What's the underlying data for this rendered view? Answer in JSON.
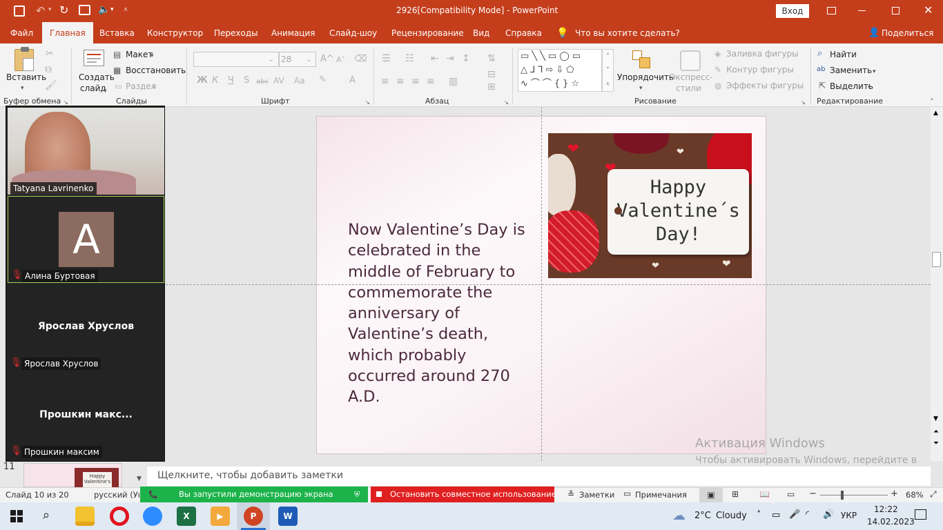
{
  "window": {
    "title": "2926[Compatibility Mode]  -  PowerPoint",
    "signin_label": "Вход"
  },
  "ribbon_tabs": [
    "Файл",
    "Главная",
    "Вставка",
    "Конструктор",
    "Переходы",
    "Анимация",
    "Слайд-шоу",
    "Рецензирование",
    "Вид",
    "Справка"
  ],
  "tell_me": "Что вы хотите сделать?",
  "share_label": "Поделиться",
  "ribbon": {
    "clipboard": {
      "paste": "Вставить",
      "group": "Буфер обмена"
    },
    "slides": {
      "new_slide_line1": "Создать",
      "new_slide_line2": "слайд",
      "layout": "Макет",
      "reset": "Восстановить",
      "section": "Раздел",
      "group": "Слайды"
    },
    "font": {
      "size": "28",
      "bold": "Ж",
      "italic": "К",
      "underline": "Ч",
      "shadow": "S",
      "strike": "abc",
      "case": "Aa",
      "color": "A",
      "group": "Шрифт"
    },
    "paragraph": {
      "group": "Абзац"
    },
    "drawing": {
      "arrange": "Упорядочить",
      "quick_styles_line1": "Экспресс-",
      "quick_styles_line2": "стили",
      "fill": "Заливка фигуры",
      "outline": "Контур фигуры",
      "effects": "Эффекты фигуры",
      "group": "Рисование"
    },
    "editing": {
      "find": "Найти",
      "replace": "Заменить",
      "select": "Выделить",
      "group": "Редактирование"
    }
  },
  "participants": [
    {
      "name": "Tatyana Lavrinenko",
      "type": "video"
    },
    {
      "name": "Алина Буртовая",
      "type": "avatar",
      "initial": "A",
      "avatar_color": "#8c6b60"
    },
    {
      "name": "Ярослав Хруслов",
      "type": "name",
      "display": "Ярослав Хруслов"
    },
    {
      "name": "Прошкин максим",
      "type": "name",
      "display": "Прошкин  макс..."
    }
  ],
  "slide": {
    "body": "Now Valentine’s Day is celebrated in the middle of February to commemorate the anniversary of Valentine’s death, which probably occurred around 270 A.D.",
    "image_text_line1": "Happy",
    "image_text_line2": "Valentine´s",
    "image_text_line3": "Day!"
  },
  "thumbnail": {
    "number": "11",
    "caption_line1": "Happy",
    "caption_line2": "Valentine's"
  },
  "notes_placeholder": "Щелкните, чтобы добавить заметки",
  "watermark": {
    "title": "Активация Windows",
    "text": "Чтобы активировать Windows, перейдите в раздел \"Параметры\"."
  },
  "status": {
    "slide_counter": "Слайд 10 из 20",
    "language": "русский (Укр",
    "sharing_notice": "Вы запустили демонстрацию экрана",
    "stop_sharing": "Остановить совместное использование",
    "notes": "Заметки",
    "comments": "Примечания",
    "zoom": "68%",
    "zoom_level": 0.68
  },
  "taskbar": {
    "weather_temp": "2°C",
    "weather_desc": "Cloudy",
    "language": "УКР",
    "time": "12:22",
    "date": "14.02.2023"
  },
  "colors": {
    "ppt_accent": "#c43e1c",
    "share_green": "#1db34b",
    "stop_red": "#e02020",
    "slide_text": "#4b2a3c"
  }
}
